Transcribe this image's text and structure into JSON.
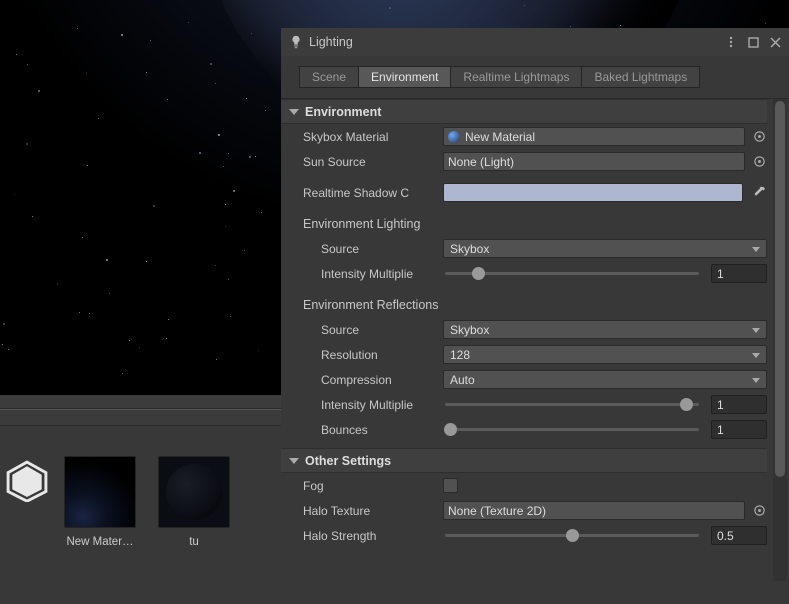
{
  "panel": {
    "title": "Lighting",
    "tabs": [
      "Scene",
      "Environment",
      "Realtime Lightmaps",
      "Baked Lightmaps"
    ],
    "active_tab_index": 1
  },
  "environment": {
    "section_label": "Environment",
    "skybox_material_label": "Skybox Material",
    "skybox_material_value": "New Material",
    "sun_source_label": "Sun Source",
    "sun_source_value": "None (Light)",
    "realtime_shadow_label": "Realtime Shadow C",
    "realtime_shadow_color": "#aeb7d0",
    "env_lighting_header": "Environment Lighting",
    "lighting_source_label": "Source",
    "lighting_source_value": "Skybox",
    "lighting_intensity_label": "Intensity Multiplie",
    "lighting_intensity_value": "1",
    "lighting_intensity_knob_pct": 13,
    "env_reflections_header": "Environment Reflections",
    "refl_source_label": "Source",
    "refl_source_value": "Skybox",
    "refl_resolution_label": "Resolution",
    "refl_resolution_value": "128",
    "refl_compression_label": "Compression",
    "refl_compression_value": "Auto",
    "refl_intensity_label": "Intensity Multiplie",
    "refl_intensity_value": "1",
    "refl_intensity_knob_pct": 95,
    "refl_bounces_label": "Bounces",
    "refl_bounces_value": "1",
    "refl_bounces_knob_pct": 2
  },
  "other": {
    "section_label": "Other Settings",
    "fog_label": "Fog",
    "fog_checked": false,
    "halo_texture_label": "Halo Texture",
    "halo_texture_value": "None (Texture 2D)",
    "halo_strength_label": "Halo Strength",
    "halo_strength_value": "0.5",
    "halo_strength_knob_pct": 50
  },
  "assets": {
    "items": [
      {
        "label": "New Mater…"
      },
      {
        "label": "tu"
      }
    ]
  }
}
